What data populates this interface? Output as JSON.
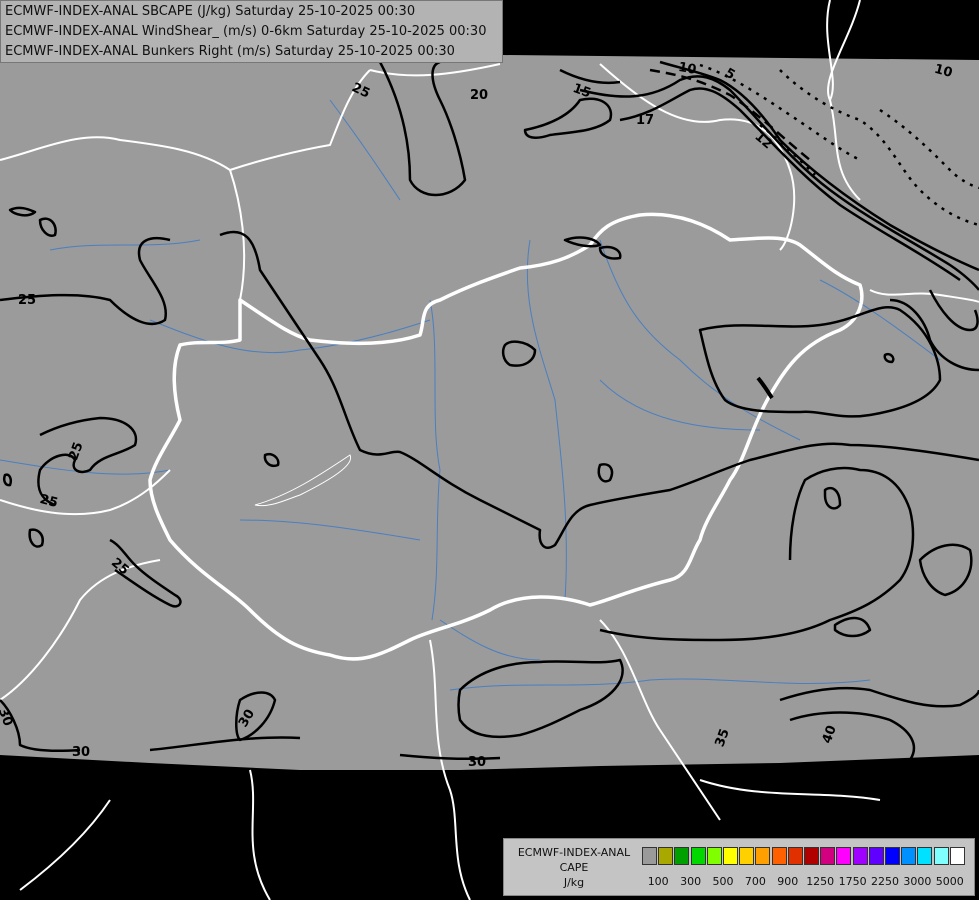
{
  "header": {
    "line1": "ECMWF-INDEX-ANAL SBCAPE (J/kg) Saturday 25-10-2025 00:30",
    "line2": "ECMWF-INDEX-ANAL WindShear_ (m/s) 0-6km Saturday 25-10-2025 00:30",
    "line3": "ECMWF-INDEX-ANAL Bunkers Right (m/s) Saturday 25-10-2025 00:30"
  },
  "legend": {
    "title1": "ECMWF-INDEX-ANAL",
    "title2": "CAPE",
    "unit": "J/kg",
    "swatch_colors": [
      "#9a9a9a",
      "#a8a800",
      "#00a000",
      "#00d800",
      "#80ff00",
      "#ffff00",
      "#ffd000",
      "#ffa000",
      "#ff6000",
      "#e03000",
      "#b00000",
      "#d00080",
      "#ff00ff",
      "#a000ff",
      "#6000ff",
      "#0000ff",
      "#0090ff",
      "#00e0ff",
      "#80ffff",
      "#ffffff"
    ],
    "ticks": [
      "100",
      "300",
      "500",
      "700",
      "900",
      "1250",
      "1750",
      "2250",
      "3000",
      "5000"
    ]
  },
  "contour_labels": {
    "c25a": "25",
    "c20": "20",
    "c15": "15",
    "c10a": "10",
    "c5": "5",
    "c17": "17",
    "c12": "12",
    "c10b": "10",
    "c25b": "25",
    "c25c": "25",
    "c25d": "25",
    "c25e": "25",
    "c30a": "30",
    "c30b": "30",
    "c30c": "30",
    "c30d": "30",
    "c35": "35",
    "c40": "40"
  },
  "colors": {
    "no_data": "#000000",
    "field": "#9b9b9b",
    "borders": "#ffffff",
    "rivers": "#4a7fc0",
    "contours": "#000000"
  }
}
